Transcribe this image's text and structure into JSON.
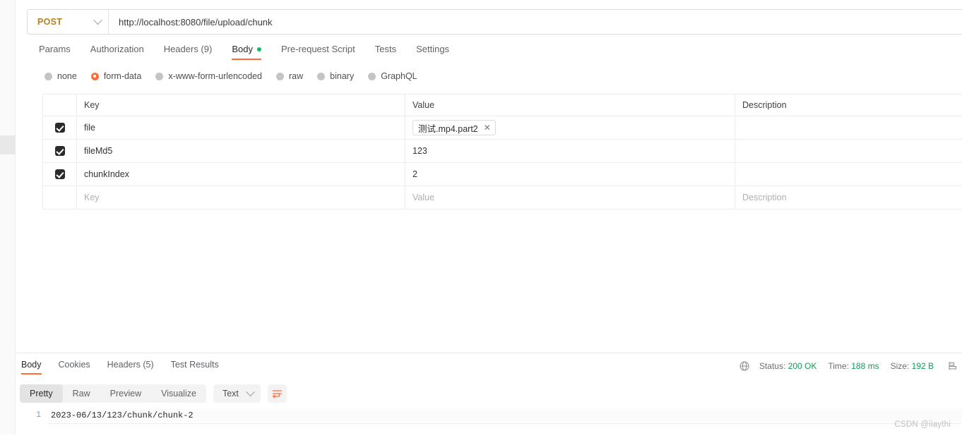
{
  "request": {
    "method": "POST",
    "url": "http://localhost:8080/file/upload/chunk",
    "tabs": [
      {
        "label": "Params",
        "active": false
      },
      {
        "label": "Authorization",
        "active": false
      },
      {
        "label": "Headers (9)",
        "active": false
      },
      {
        "label": "Body",
        "active": true,
        "dot": true
      },
      {
        "label": "Pre-request Script",
        "active": false
      },
      {
        "label": "Tests",
        "active": false
      },
      {
        "label": "Settings",
        "active": false
      }
    ],
    "body_types": [
      {
        "label": "none",
        "selected": false
      },
      {
        "label": "form-data",
        "selected": true
      },
      {
        "label": "x-www-form-urlencoded",
        "selected": false
      },
      {
        "label": "raw",
        "selected": false
      },
      {
        "label": "binary",
        "selected": false
      },
      {
        "label": "GraphQL",
        "selected": false
      }
    ],
    "table": {
      "columns": {
        "key": "Key",
        "value": "Value",
        "description": "Description"
      },
      "rows": [
        {
          "checked": true,
          "key": "file",
          "value": "测试.mp4.part2",
          "is_file": true,
          "description": ""
        },
        {
          "checked": true,
          "key": "fileMd5",
          "value": "123",
          "is_file": false,
          "description": ""
        },
        {
          "checked": true,
          "key": "chunkIndex",
          "value": "2",
          "is_file": false,
          "description": ""
        }
      ],
      "empty_row": {
        "key": "Key",
        "value": "Value",
        "description": "Description"
      }
    }
  },
  "response": {
    "tabs": [
      {
        "label": "Body",
        "active": true
      },
      {
        "label": "Cookies",
        "active": false
      },
      {
        "label": "Headers (5)",
        "active": false
      },
      {
        "label": "Test Results",
        "active": false
      }
    ],
    "status": {
      "status_label": "Status:",
      "status_value": "200 OK",
      "time_label": "Time:",
      "time_value": "188 ms",
      "size_label": "Size:",
      "size_value": "192 B"
    },
    "formats": [
      {
        "label": "Pretty",
        "active": true
      },
      {
        "label": "Raw",
        "active": false
      },
      {
        "label": "Preview",
        "active": false
      },
      {
        "label": "Visualize",
        "active": false
      }
    ],
    "content_type": "Text",
    "body_lines": [
      {
        "number": "1",
        "text": "2023-06/13/123/chunk/chunk-2"
      }
    ]
  },
  "watermark": "CSDN @iiaythi",
  "colors": {
    "accent": "#ff6c37",
    "method": "#b58121",
    "success": "#0f9d58",
    "body_dot": "#14b866"
  }
}
